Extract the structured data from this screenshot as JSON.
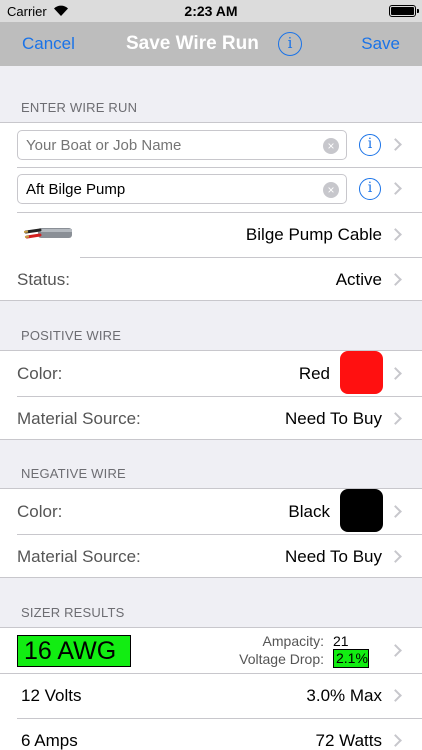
{
  "status_bar": {
    "carrier": "Carrier",
    "time": "2:23 AM"
  },
  "nav": {
    "cancel": "Cancel",
    "title": "Save Wire Run",
    "info_glyph": "i",
    "save": "Save"
  },
  "enter_wire_run": {
    "header": "ENTER WIRE RUN",
    "boat_name_placeholder": "Your Boat or Job Name",
    "run_name_value": "Aft Bilge Pump",
    "cable_type": "Bilge Pump Cable",
    "status_label": "Status:",
    "status_value": "Active"
  },
  "positive_wire": {
    "header": "POSITIVE WIRE",
    "color_label": "Color:",
    "color_value": "Red",
    "swatch_color": "#ff1010",
    "material_label": "Material Source:",
    "material_value": "Need To Buy"
  },
  "negative_wire": {
    "header": "NEGATIVE WIRE",
    "color_label": "Color:",
    "color_value": "Black",
    "swatch_color": "#000000",
    "material_label": "Material Source:",
    "material_value": "Need To Buy"
  },
  "sizer_results": {
    "header": "SIZER RESULTS",
    "awg": "16 AWG",
    "ampacity_label": "Ampacity:",
    "ampacity_value": "21",
    "voltage_drop_label": "Voltage Drop:",
    "voltage_drop_value": "2.1%",
    "volts": "12 Volts",
    "max_drop": "3.0% Max",
    "amps": "6 Amps",
    "watts": "72 Watts"
  },
  "colors": {
    "accent": "#1a73e8",
    "highlight": "#12ed12",
    "navbar": "#bdbdbd"
  },
  "icons": [
    "wifi-icon",
    "battery-icon",
    "info-icon",
    "clear-icon",
    "chevron-right-icon",
    "cable-image"
  ]
}
